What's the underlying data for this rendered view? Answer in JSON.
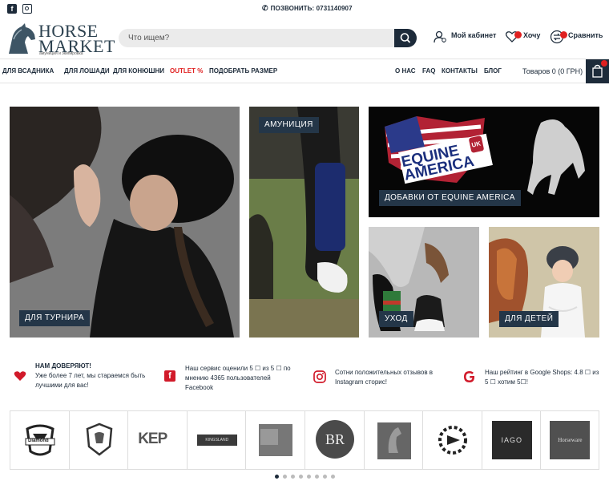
{
  "topbar": {
    "facebook_icon": "facebook-icon",
    "instagram_icon": "instagram-icon",
    "phone_text": "ПОЗВОНИТЬ: 0731140907"
  },
  "header": {
    "logo_line1": "HORSE",
    "logo_line2": "MARKET",
    "logo_tagline": "амуниция и экипировка",
    "search_placeholder": "Что ищем?",
    "account_label": "Мой кабинет",
    "wishlist_label": "Хочу",
    "compare_label": "Сравнить"
  },
  "nav": {
    "items": [
      "ДЛЯ ВСАДНИКА",
      "ДЛЯ ЛОШАДИ",
      "ДЛЯ КОНЮШНИ",
      "OUTLET %",
      "ПОДОБРАТЬ РАЗМЕР"
    ],
    "right_items": [
      "О НАС",
      "FAQ",
      "КОНТАКТЫ",
      "БЛОГ"
    ],
    "cart_text": "Товаров 0 (0 ГРН)"
  },
  "banners": {
    "tournament": "ДЛЯ ТУРНИРА",
    "equipment": "АМУНИЦИЯ",
    "equine": "ДОБАВКИ ОТ EQUINE AMERICA",
    "equine_logo_1": "EQUINE",
    "equine_logo_2": "AMERICA",
    "equine_logo_uk": "UK",
    "care": "УХОД",
    "kids": "ДЛЯ ДЕТЕЙ"
  },
  "trust": {
    "t1_title": "НАМ ДОВЕРЯЮТ!",
    "t1_line1": "Уже более 7 лет, мы стараемся быть",
    "t1_line2": "лучшими для вас!",
    "t2_line1": "Наш сервис оценили 5 ☐ из 5 ☐ по",
    "t2_line2": "мнению 4365 пользователей",
    "t2_line3": "Facebook",
    "t3_line1": "Сотни положительных отзывов в",
    "t3_line2": "Instagram сторис!",
    "t4_line1": "Наш рейтинг в Google Shops: 4.8 ☐ из",
    "t4_line2": "5 ☐ хотим 5☐!"
  },
  "brands": [
    "Diamond",
    "",
    "KEP",
    "KINGSLAND",
    "",
    "BR",
    "",
    "",
    "IAGO",
    "Horseware"
  ],
  "carousel": {
    "count": 8,
    "active": 0
  },
  "colors": {
    "primary": "#1d2b3a",
    "accent": "#e02020",
    "label_bg": "#243648"
  }
}
